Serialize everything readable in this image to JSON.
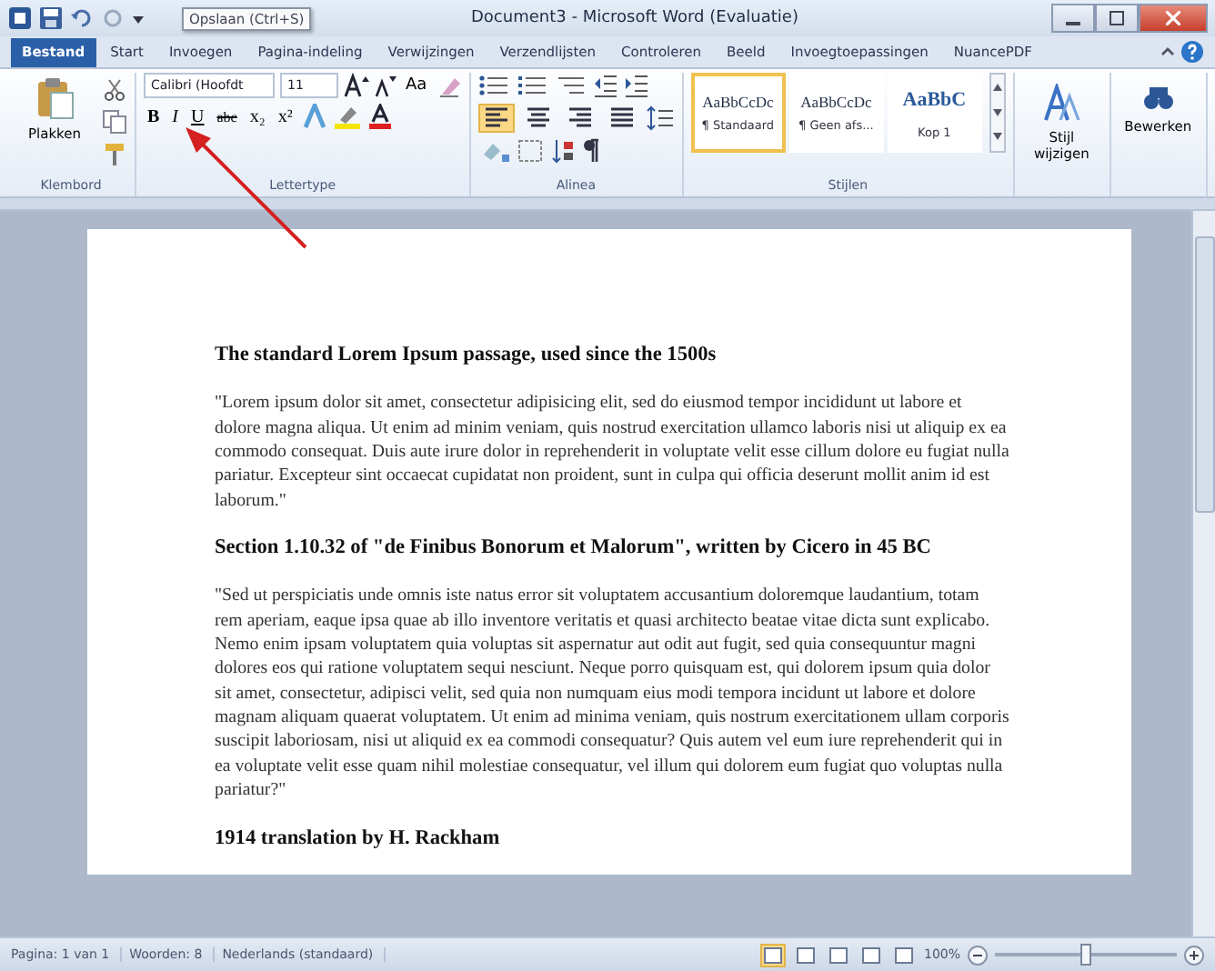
{
  "window": {
    "title": "Document3 - Microsoft Word (Evaluatie)"
  },
  "tabs": [
    {
      "label": "Bestand",
      "selected": true
    },
    {
      "label": "Start",
      "selected": false
    },
    {
      "label": "Invoegen",
      "selected": false
    },
    {
      "label": "Pagina-indeling",
      "selected": false
    },
    {
      "label": "Verwijzingen",
      "selected": false
    },
    {
      "label": "Verzendlijsten",
      "selected": false
    },
    {
      "label": "Controleren",
      "selected": false
    },
    {
      "label": "Beeld",
      "selected": false
    },
    {
      "label": "Invoegtoepassingen",
      "selected": false
    },
    {
      "label": "NuancePDF",
      "selected": false
    }
  ],
  "tooltip": {
    "text": "Opslaan (Ctrl+S)"
  },
  "clipboard": {
    "paste_label": "Plakken",
    "label": "Klembord"
  },
  "font": {
    "font_name": "Calibri (Hoofdt",
    "font_size": "11",
    "change_case": "Aa",
    "format_buttons": [
      "B",
      "I",
      "U",
      "abc",
      "x₂",
      "x²"
    ],
    "label": "Lettertype"
  },
  "paragraph": {
    "label": "Alinea",
    "alignments": [
      {
        "selected": true
      },
      {
        "selected": false
      },
      {
        "selected": false
      },
      {
        "selected": false
      }
    ]
  },
  "styles": {
    "label": "Stijlen",
    "items": [
      {
        "preview": "AaBbCcDc",
        "name": "¶ Standaard",
        "selected": true
      },
      {
        "preview": "AaBbCcDc",
        "name": "¶ Geen afs...",
        "selected": false
      },
      {
        "preview": "AaBbC",
        "name": "Kop 1",
        "selected": false
      }
    ],
    "change_label": "Stijl wijzigen"
  },
  "editing": {
    "label": "Bewerken"
  },
  "document": {
    "blocks": [
      {
        "kind": "heading",
        "text": "The standard Lorem Ipsum passage, used since the 1500s"
      },
      {
        "kind": "paragraph",
        "text": "\"Lorem ipsum dolor sit amet, consectetur adipisicing elit, sed do eiusmod tempor incididunt ut labore et dolore magna aliqua. Ut enim ad minim veniam, quis nostrud exercitation ullamco laboris nisi ut aliquip ex ea commodo consequat. Duis aute irure dolor in reprehenderit in voluptate velit esse cillum dolore eu fugiat nulla pariatur. Excepteur sint occaecat cupidatat non proident, sunt in culpa qui officia deserunt mollit anim id est laborum.\""
      },
      {
        "kind": "heading",
        "text": "Section 1.10.32 of \"de Finibus Bonorum et Malorum\", written by Cicero in 45 BC"
      },
      {
        "kind": "paragraph",
        "text": "\"Sed ut perspiciatis unde omnis iste natus error sit voluptatem accusantium doloremque laudantium, totam rem aperiam, eaque ipsa quae ab illo inventore veritatis et quasi architecto beatae vitae dicta sunt explicabo. Nemo enim ipsam voluptatem quia voluptas sit aspernatur aut odit aut fugit, sed quia consequuntur magni dolores eos qui ratione voluptatem sequi nesciunt. Neque porro quisquam est, qui dolorem ipsum quia dolor sit amet, consectetur, adipisci velit, sed quia non numquam eius modi tempora incidunt ut labore et dolore magnam aliquam quaerat voluptatem. Ut enim ad minima veniam, quis nostrum exercitationem ullam corporis suscipit laboriosam, nisi ut aliquid ex ea commodi consequatur? Quis autem vel eum iure reprehenderit qui in ea voluptate velit esse quam nihil molestiae consequatur, vel illum qui dolorem eum fugiat quo voluptas nulla pariatur?\""
      },
      {
        "kind": "heading",
        "text": "1914 translation by H. Rackham"
      }
    ]
  },
  "status_bar": {
    "page": "Pagina: 1 van 1",
    "words": "Woorden: 8",
    "language": "Nederlands (standaard)",
    "views": [
      {
        "selected": true
      },
      {
        "selected": false
      },
      {
        "selected": false
      },
      {
        "selected": false
      },
      {
        "selected": false
      }
    ],
    "zoom": "100%",
    "zoom_slider": {
      "level": 0.5
    }
  }
}
